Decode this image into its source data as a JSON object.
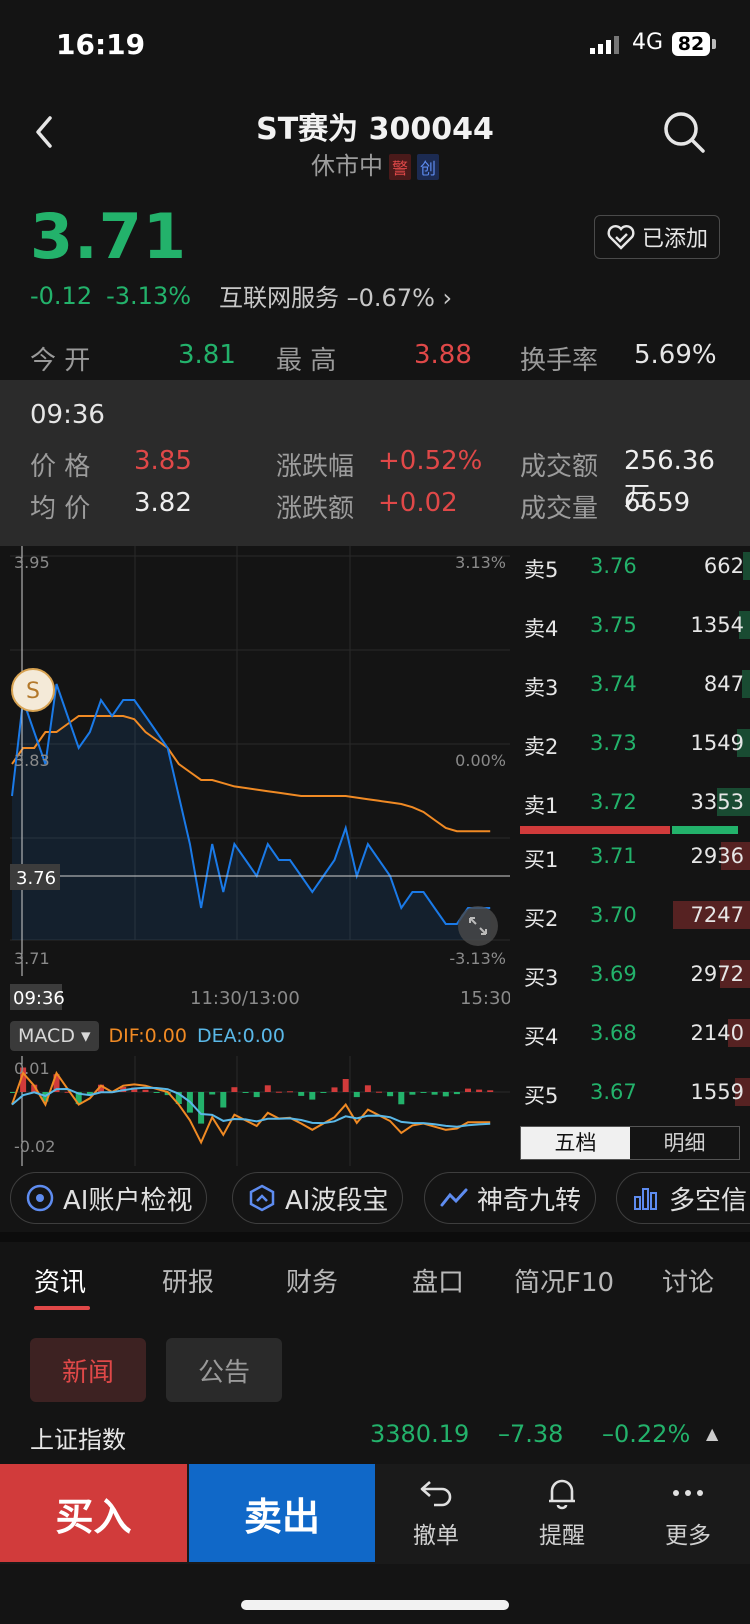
{
  "status": {
    "time": "16:19",
    "network": "4G",
    "battery": "82"
  },
  "header": {
    "title": "ST赛为  300044",
    "subtitle": "休市中",
    "tag_warn": "警",
    "tag_gem": "创"
  },
  "quote": {
    "price": "3.71",
    "change": "-0.12",
    "change_pct": "-3.13%",
    "industry": "互联网服务",
    "industry_pct": "–0.67%",
    "watch_label": "已添加"
  },
  "stats": {
    "open_label": "今 开",
    "open": "3.81",
    "high_label": "最 高",
    "high": "3.88",
    "turnover_label": "换手率",
    "turnover": "5.69%"
  },
  "crosshair_info": {
    "time": "09:36",
    "price_label": "价 格",
    "price": "3.85",
    "pct_label": "涨跌幅",
    "pct": "+0.52%",
    "amount_label": "成交额",
    "amount": "256.36万",
    "avg_label": "均 价",
    "avg": "3.82",
    "chg_label": "涨跌额",
    "chg": "+0.02",
    "volume_label": "成交量",
    "volume": "6659"
  },
  "chart_data": {
    "type": "line",
    "y_ticks_left": [
      "3.95",
      "3.83",
      "3.71"
    ],
    "y_ticks_right": [
      "3.13%",
      "0.00%",
      "-3.13%"
    ],
    "x_ticks": [
      "09:36",
      "11:30/13:00",
      "15:30"
    ],
    "crosshair_price": "3.76",
    "crosshair_time": "09:36",
    "ylim": [
      3.71,
      3.95
    ],
    "series": [
      {
        "values": [
          3.8,
          3.86,
          3.84,
          3.82,
          3.87,
          3.85,
          3.83,
          3.84,
          3.86,
          3.85,
          3.86,
          3.86,
          3.85,
          3.84,
          3.83,
          3.8,
          3.77,
          3.73,
          3.77,
          3.74,
          3.77,
          3.76,
          3.75,
          3.77,
          3.76,
          3.76,
          3.75,
          3.74,
          3.75,
          3.76,
          3.78,
          3.75,
          3.77,
          3.76,
          3.75,
          3.73,
          3.74,
          3.74,
          3.73,
          3.72,
          3.72,
          3.73,
          3.73,
          3.73
        ]
      },
      {
        "values": [
          3.82,
          3.83,
          3.83,
          3.84,
          3.84,
          3.845,
          3.85,
          3.85,
          3.85,
          3.85,
          3.85,
          3.848,
          3.84,
          3.835,
          3.83,
          3.82,
          3.815,
          3.81,
          3.81,
          3.808,
          3.806,
          3.805,
          3.804,
          3.803,
          3.802,
          3.801,
          3.8,
          3.8,
          3.8,
          3.8,
          3.8,
          3.799,
          3.798,
          3.797,
          3.796,
          3.795,
          3.793,
          3.79,
          3.785,
          3.78,
          3.778,
          3.778,
          3.778,
          3.778
        ]
      }
    ]
  },
  "macd": {
    "selector": "MACD",
    "dif": "DIF:0.00",
    "dea": "DEA:0.00",
    "y_top": "0.01",
    "y_bottom": "-0.02"
  },
  "order_book": {
    "asks": [
      {
        "label": "卖5",
        "price": "3.76",
        "vol": "662",
        "ratio": 0.06
      },
      {
        "label": "卖4",
        "price": "3.75",
        "vol": "1354",
        "ratio": 0.1
      },
      {
        "label": "卖3",
        "price": "3.74",
        "vol": "847",
        "ratio": 0.07
      },
      {
        "label": "卖2",
        "price": "3.73",
        "vol": "1549",
        "ratio": 0.12
      },
      {
        "label": "卖1",
        "price": "3.72",
        "vol": "3353",
        "ratio": 0.3
      }
    ],
    "bids": [
      {
        "label": "买1",
        "price": "3.71",
        "vol": "2936",
        "ratio": 0.26
      },
      {
        "label": "买2",
        "price": "3.70",
        "vol": "7247",
        "ratio": 0.7
      },
      {
        "label": "买3",
        "price": "3.69",
        "vol": "2972",
        "ratio": 0.27
      },
      {
        "label": "买4",
        "price": "3.68",
        "vol": "2140",
        "ratio": 0.2
      },
      {
        "label": "买5",
        "price": "3.67",
        "vol": "1559",
        "ratio": 0.14
      }
    ],
    "tab_five": "五档",
    "tab_detail": "明细"
  },
  "tools": [
    "AI账户检视",
    "AI波段宝",
    "神奇九转",
    "多空信"
  ],
  "news_tabs": [
    "资讯",
    "研报",
    "财务",
    "盘口",
    "简况F10",
    "讨论"
  ],
  "news_sub": {
    "news": "新闻",
    "notice": "公告"
  },
  "index_ticker": {
    "name": "上证指数",
    "value": "3380.19",
    "change": "–7.38",
    "pct": "–0.22%"
  },
  "bottom": {
    "buy": "买入",
    "sell": "卖出",
    "cancel": "撤单",
    "alert": "提醒",
    "more": "更多"
  },
  "colors": {
    "up": "#e04848",
    "down": "#23b26b",
    "price_line": "#1a7ae8",
    "avg_line": "#f08a24",
    "sell_btn": "#1068c8",
    "buy_btn": "#d13b3b"
  }
}
